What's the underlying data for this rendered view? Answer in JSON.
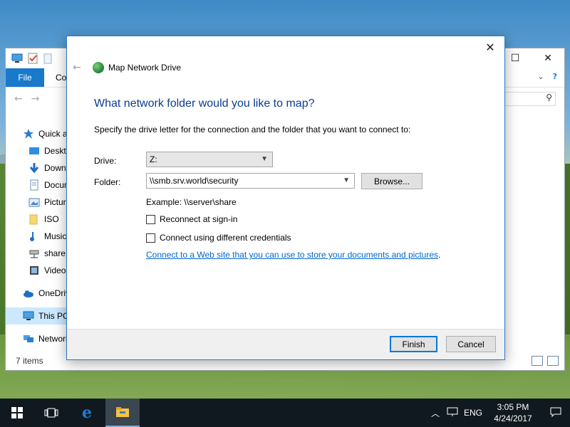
{
  "explorer": {
    "file_tab": "File",
    "second_tab_fragment": "Co",
    "items": [
      {
        "label": "Quick access",
        "icon": "star-icon"
      },
      {
        "label": "Desktop",
        "icon": "desktop-icon"
      },
      {
        "label": "Downloads",
        "icon": "download-icon"
      },
      {
        "label": "Documents",
        "icon": "document-icon"
      },
      {
        "label": "Pictures",
        "icon": "picture-icon"
      },
      {
        "label": "ISO",
        "icon": "folder-icon"
      },
      {
        "label": "Music",
        "icon": "music-icon"
      },
      {
        "label": "share",
        "icon": "network-drive-icon"
      },
      {
        "label": "Videos",
        "icon": "video-icon"
      },
      {
        "label": "OneDrive",
        "icon": "cloud-icon"
      },
      {
        "label": "This PC",
        "icon": "computer-icon"
      },
      {
        "label": "Network",
        "icon": "network-icon"
      }
    ],
    "status": "7 items"
  },
  "dialog": {
    "title": "Map Network Drive",
    "heading": "What network folder would you like to map?",
    "description": "Specify the drive letter for the connection and the folder that you want to connect to:",
    "drive_label": "Drive:",
    "drive_value": "Z:",
    "folder_label": "Folder:",
    "folder_value": "\\\\smb.srv.world\\security",
    "browse_label": "Browse...",
    "example": "Example: \\\\server\\share",
    "reconnect_label": "Reconnect at sign-in",
    "credentials_label": "Connect using different credentials",
    "link_text": "Connect to a Web site that you can use to store your documents and pictures",
    "link_suffix": ".",
    "finish_label": "Finish",
    "cancel_label": "Cancel"
  },
  "taskbar": {
    "language": "ENG",
    "time": "3:05 PM",
    "date": "4/24/2017"
  }
}
